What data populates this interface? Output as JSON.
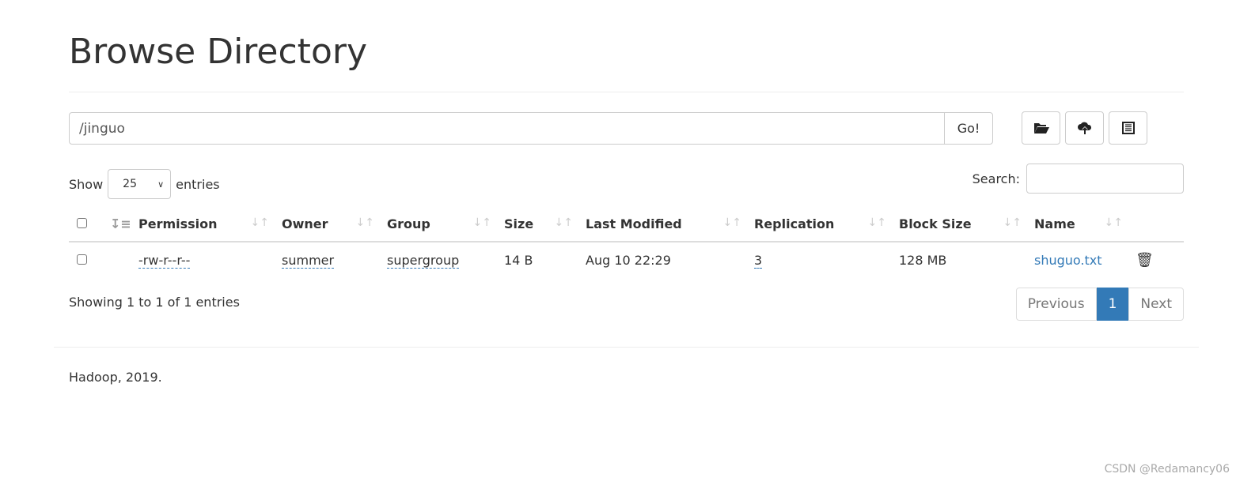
{
  "title": "Browse Directory",
  "path": "/jinguo",
  "go_label": "Go!",
  "toolbar": {
    "icons": [
      "folder-open-icon",
      "cloud-upload-icon",
      "list-icon"
    ]
  },
  "show": {
    "label": "Show",
    "value": "25",
    "suffix": "entries"
  },
  "search": {
    "label": "Search:",
    "value": ""
  },
  "columns": [
    "Permission",
    "Owner",
    "Group",
    "Size",
    "Last Modified",
    "Replication",
    "Block Size",
    "Name"
  ],
  "rows": [
    {
      "permission": "-rw-r--r--",
      "owner": "summer",
      "group": "supergroup",
      "size": "14 B",
      "modified": "Aug 10 22:29",
      "replication": "3",
      "block_size": "128 MB",
      "name": "shuguo.txt"
    }
  ],
  "info": "Showing 1 to 1 of 1 entries",
  "pagination": {
    "previous": "Previous",
    "current": "1",
    "next": "Next"
  },
  "footer": "Hadoop, 2019.",
  "watermark": "CSDN @Redamancy06"
}
